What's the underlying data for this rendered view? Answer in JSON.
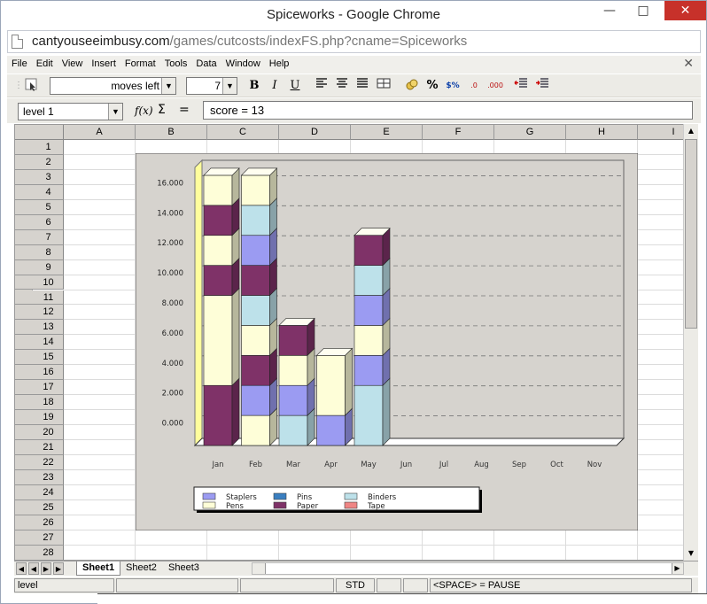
{
  "window": {
    "title": "Spiceworks - Google Chrome"
  },
  "address_bar": {
    "host": "cantyouseeimbusy.com",
    "path": "/games/cutcosts/indexFS.php?cname=Spiceworks"
  },
  "menu": {
    "items": [
      "File",
      "Edit",
      "View",
      "Insert",
      "Format",
      "Tools",
      "Data",
      "Window",
      "Help"
    ]
  },
  "toolbar": {
    "font_combo_value": "moves left",
    "size_combo_value": "7",
    "bold": "B",
    "italic": "I",
    "underline": "U"
  },
  "formula_bar": {
    "cell_ref": "level  1",
    "fx_label": "f(x)",
    "sigma": "Σ",
    "equals": "=",
    "formula": "score =  13"
  },
  "grid": {
    "columns": [
      "A",
      "B",
      "C",
      "D",
      "E",
      "F",
      "G",
      "H",
      "I"
    ],
    "rows": [
      "1",
      "2",
      "3",
      "4",
      "5",
      "6",
      "7",
      "8",
      "9",
      "10",
      "11",
      "12",
      "13",
      "14",
      "15",
      "16",
      "17",
      "18",
      "19",
      "20",
      "21",
      "22",
      "23",
      "24",
      "25",
      "26",
      "27",
      "28"
    ]
  },
  "sheets": {
    "tabs": [
      "Sheet1",
      "Sheet2",
      "Sheet3"
    ],
    "active": "Sheet1"
  },
  "status_bar": {
    "left": "level",
    "mode": "STD",
    "hint": "<SPACE> = PAUSE"
  },
  "chart_data": {
    "type": "bar",
    "stacked": true,
    "categories": [
      "Jan",
      "Feb",
      "Mar",
      "Apr",
      "May",
      "Jun",
      "Jul",
      "Aug",
      "Sep",
      "Oct",
      "Nov"
    ],
    "ytick_labels": [
      "0.000",
      "2.000",
      "4.000",
      "6.000",
      "8.000",
      "10.000",
      "12.000",
      "14.000",
      "16.000"
    ],
    "ylim": [
      -1.5,
      17.5
    ],
    "grid": true,
    "legend_position": "bottom",
    "legend": [
      {
        "name": "Staplers",
        "color": "#9b9bf2"
      },
      {
        "name": "Pens",
        "color": "#fefed8"
      },
      {
        "name": "Pins",
        "color": "#3a7fc0"
      },
      {
        "name": "Paper",
        "color": "#7f3268"
      },
      {
        "name": "Binders",
        "color": "#bde1ea"
      },
      {
        "name": "Tape",
        "color": "#ef8584"
      }
    ],
    "bars": [
      {
        "category": "Jan",
        "segments": [
          {
            "series": "Paper",
            "value": 4
          },
          {
            "series": "Pens",
            "value": 6
          },
          {
            "series": "Paper",
            "value": 2
          },
          {
            "series": "Pens",
            "value": 2
          },
          {
            "series": "Paper",
            "value": 2
          },
          {
            "series": "Pens",
            "value": 2
          }
        ]
      },
      {
        "category": "Feb",
        "segments": [
          {
            "series": "Pens",
            "value": 2
          },
          {
            "series": "Staplers",
            "value": 2
          },
          {
            "series": "Paper",
            "value": 2
          },
          {
            "series": "Pens",
            "value": 2
          },
          {
            "series": "Binders",
            "value": 2
          },
          {
            "series": "Paper",
            "value": 2
          },
          {
            "series": "Staplers",
            "value": 2
          },
          {
            "series": "Binders",
            "value": 2
          },
          {
            "series": "Pens",
            "value": 2
          }
        ]
      },
      {
        "category": "Mar",
        "segments": [
          {
            "series": "Binders",
            "value": 2
          },
          {
            "series": "Staplers",
            "value": 2
          },
          {
            "series": "Pens",
            "value": 2
          },
          {
            "series": "Paper",
            "value": 2
          }
        ]
      },
      {
        "category": "Apr",
        "segments": [
          {
            "series": "Staplers",
            "value": 2
          },
          {
            "series": "Pens",
            "value": 4
          }
        ]
      },
      {
        "category": "May",
        "segments": [
          {
            "series": "Binders",
            "value": 4
          },
          {
            "series": "Staplers",
            "value": 2
          },
          {
            "series": "Pens",
            "value": 2
          },
          {
            "series": "Staplers",
            "value": 2
          },
          {
            "series": "Binders",
            "value": 2
          },
          {
            "series": "Paper",
            "value": 2
          }
        ]
      }
    ]
  }
}
